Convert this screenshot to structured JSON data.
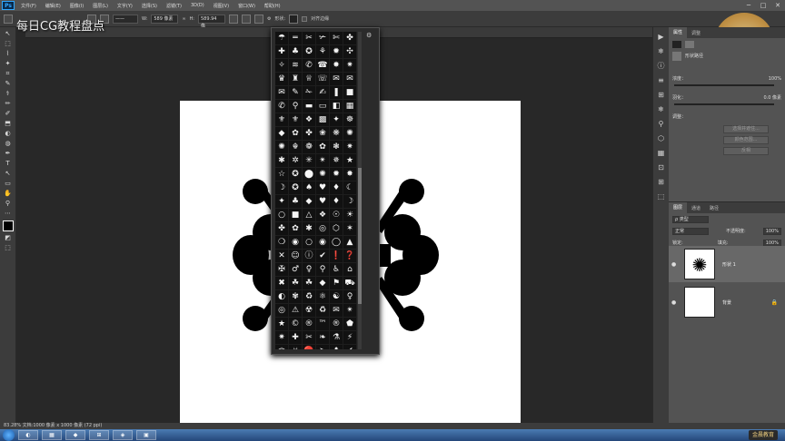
{
  "app": {
    "logo": "Ps"
  },
  "menu": [
    "文件(F)",
    "编辑(E)",
    "图像(I)",
    "图层(L)",
    "文字(Y)",
    "选择(S)",
    "滤镜(T)",
    "3D(D)",
    "视图(V)",
    "窗口(W)",
    "帮助(H)"
  ],
  "window_controls": {
    "minimize": "─",
    "maximize": "□",
    "close": "✕"
  },
  "options": {
    "stroke_style": "——",
    "w_label": "W:",
    "w_value": "589 像素",
    "h_label": "H:",
    "h_value": "589.94 像",
    "shape_label": "形状:",
    "align_label": "对齐边缘"
  },
  "watermark": "每日CG教程盘点",
  "brand_logo_text": "金晨教育",
  "status": "83.28%  文档:1000 像素 x 1000 像素 (72 ppi)",
  "picker": {
    "shapes": [
      "☂",
      "═",
      "✂",
      "✃",
      "✄",
      "✤",
      "✚",
      "♣",
      "✪",
      "⚘",
      "✹",
      "✣",
      "✧",
      "≋",
      "✆",
      "☎",
      "✸",
      "✷",
      "♛",
      "♜",
      "♕",
      "☏",
      "✉",
      "✉",
      "✉",
      "✎",
      "✁",
      "✍",
      "❚",
      "■",
      "✆",
      "⚲",
      "▬",
      "▭",
      "◧",
      "▦",
      "⚜",
      "⚜",
      "❖",
      "▩",
      "✦",
      "☸",
      "◆",
      "✿",
      "✤",
      "❀",
      "❋",
      "✺",
      "✺",
      "☬",
      "❁",
      "✿",
      "❃",
      "✷",
      "✱",
      "✲",
      "✳",
      "✴",
      "✵",
      "★",
      "☆",
      "✪",
      "⬤",
      "✺",
      "✹",
      "✸",
      "☽",
      "✪",
      "♠",
      "♥",
      "♦",
      "☾",
      "✦",
      "♣",
      "◆",
      "♥",
      "♦",
      "☽",
      "○",
      "■",
      "△",
      "❖",
      "☉",
      "☀",
      "✤",
      "✿",
      "✱",
      "◎",
      "⬡",
      "✶",
      "❍",
      "◉",
      "○",
      "◉",
      "◯",
      "▲",
      "✕",
      "☺",
      "ⓘ",
      "✔",
      "❗",
      "❓",
      "✠",
      "♂",
      "♀",
      "⚲",
      "♿",
      "⌂",
      "✖",
      "☘",
      "☘",
      "◆",
      "⚑",
      "⛟",
      "◐",
      "✾",
      "♻",
      "⚛",
      "☯",
      "♀",
      "◎",
      "⚠",
      "☢",
      "♻",
      "✉",
      "✴",
      "★",
      "©",
      "®",
      "™",
      "®",
      "⬟",
      "✷",
      "✚",
      "✂",
      "❧",
      "⚗",
      "⚡",
      "⚖",
      "☣",
      "⛔",
      "➤",
      "⬆",
      "✔",
      "▬",
      "▭",
      "▬",
      "◯",
      "▭"
    ],
    "gear": "⚙"
  },
  "tools": [
    "↖",
    "⬚",
    "⌇",
    "✦",
    "⌗",
    "✎",
    "⚕",
    "✏",
    "✐",
    "⬒",
    "◐",
    "◍",
    "✒",
    "T",
    "↖",
    "▭",
    "✋",
    "⚲",
    "⋯",
    "◩",
    "⬚"
  ],
  "dock": [
    "▶",
    "❄",
    "ⓘ",
    "≡",
    "⊞",
    "❄",
    "⚲",
    "⬡",
    "▦",
    "⊡",
    "⊞",
    "⬚"
  ],
  "properties": {
    "tab1": "属性",
    "tab2": "调整",
    "layer_type": "形状路径",
    "density_label": "浓度：",
    "density_value": "100%",
    "feather_label": "羽化：",
    "feather_value": "0.0 像素",
    "refine_label": "调整：",
    "btn1": "选择并遮住...",
    "btn2": "颜色范围...",
    "btn3": "反相"
  },
  "layers": {
    "tabs": [
      "图层",
      "通道",
      "路径"
    ],
    "kind": "ρ 类型",
    "blend_mode": "正常",
    "opacity_label": "不透明度:",
    "opacity_value": "100%",
    "lock_label": "锁定:",
    "fill_label": "填充:",
    "fill_value": "100%",
    "items": [
      {
        "name": "形状 1",
        "thumb": "✺"
      },
      {
        "name": "背景",
        "thumb": ""
      }
    ]
  },
  "taskbar": [
    "◐",
    "▦",
    "◆",
    "⊞",
    "◈",
    "▣"
  ],
  "colors": {
    "accent": "#31a8ff",
    "panel": "#535353",
    "canvas_bg": "#282828"
  }
}
